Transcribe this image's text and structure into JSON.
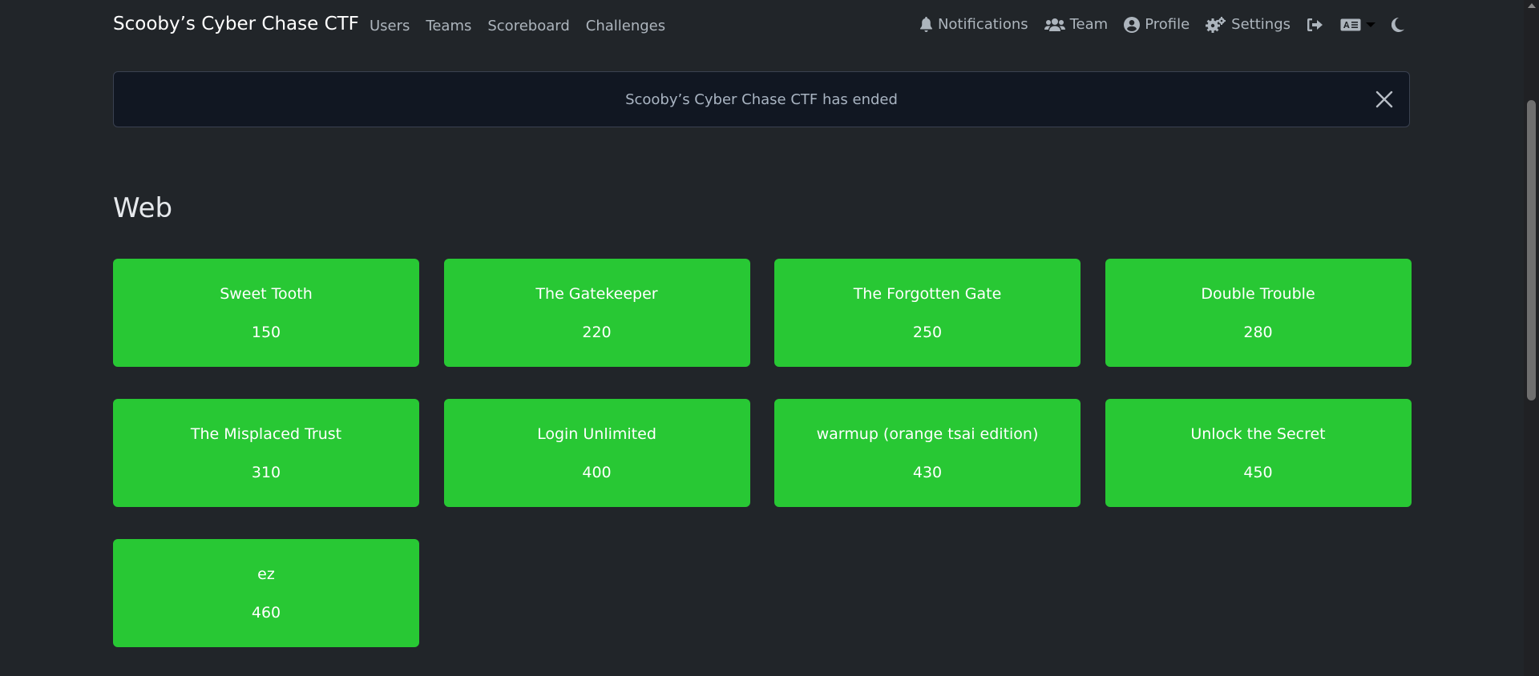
{
  "navbar": {
    "brand": "Scooby’s Cyber Chase CTF",
    "links": [
      {
        "label": "Users"
      },
      {
        "label": "Teams"
      },
      {
        "label": "Scoreboard"
      },
      {
        "label": "Challenges"
      }
    ],
    "right": {
      "notifications": {
        "label": "Notifications",
        "icon": "bell-icon"
      },
      "team": {
        "label": "Team",
        "icon": "users-icon"
      },
      "profile": {
        "label": "Profile",
        "icon": "user-circle-icon"
      },
      "settings": {
        "label": "Settings",
        "icon": "gears-icon"
      },
      "logout_icon": "sign-out-icon",
      "language_icon": "language-icon",
      "theme_icon": "moon-icon"
    }
  },
  "alert": {
    "message": "Scooby’s Cyber Chase CTF has ended",
    "close_icon": "close-icon"
  },
  "category": {
    "title": "Web",
    "challenges": [
      {
        "name": "Sweet Tooth",
        "value": "150"
      },
      {
        "name": "The Gatekeeper",
        "value": "220"
      },
      {
        "name": "The Forgotten Gate",
        "value": "250"
      },
      {
        "name": "Double Trouble",
        "value": "280"
      },
      {
        "name": "The Misplaced Trust",
        "value": "310"
      },
      {
        "name": "Login Unlimited",
        "value": "400"
      },
      {
        "name": "warmup (orange tsai edition)",
        "value": "430"
      },
      {
        "name": "Unlock the Secret",
        "value": "450"
      },
      {
        "name": "ez",
        "value": "460"
      }
    ]
  },
  "colors": {
    "background": "#212529",
    "solved_card": "#28c834",
    "alert_background": "#111722"
  }
}
